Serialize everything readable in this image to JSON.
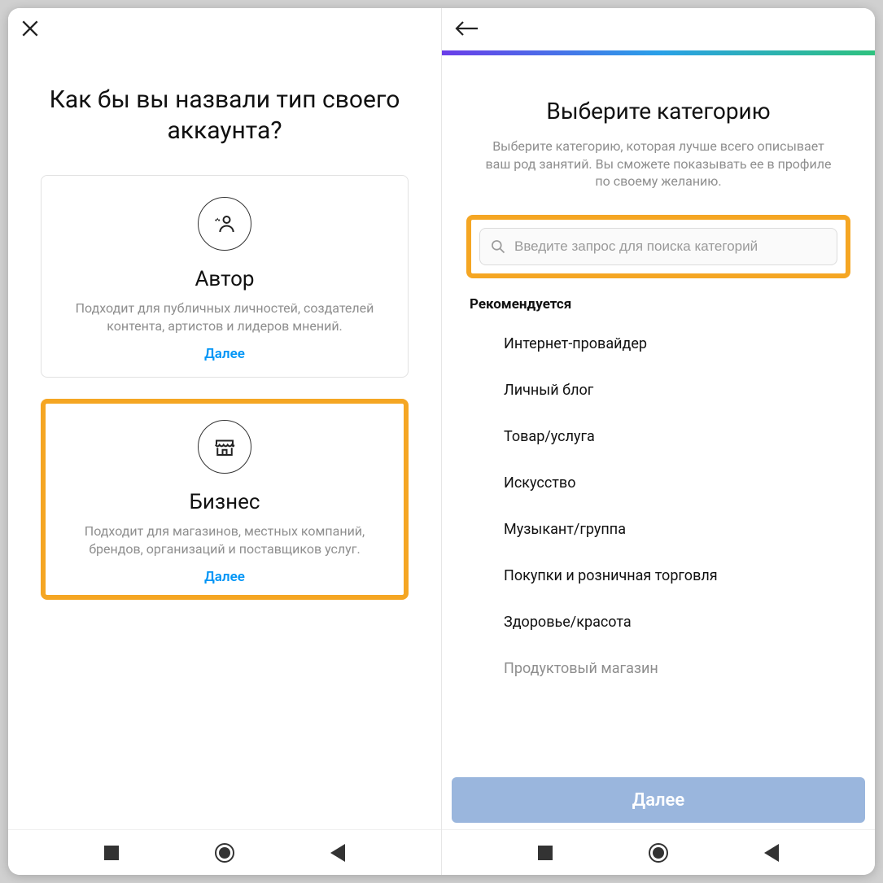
{
  "left": {
    "heading": "Как бы вы назвали тип своего аккаунта?",
    "cards": {
      "author": {
        "title": "Автор",
        "desc": "Подходит для публичных личностей, создателей контента, артистов и лидеров мнений.",
        "next": "Далее"
      },
      "business": {
        "title": "Бизнес",
        "desc": "Подходит для магазинов, местных компаний, брендов, организаций и поставщиков услуг.",
        "next": "Далее"
      }
    }
  },
  "right": {
    "heading": "Выберите категорию",
    "sub": "Выберите категорию, которая лучше всего описывает ваш род занятий. Вы сможете показывать ее в профиле по своему желанию.",
    "search_placeholder": "Введите запрос для поиска категорий",
    "recommended_label": "Рекомендуется",
    "categories": [
      "Интернет-провайдер",
      "Личный блог",
      "Товар/услуга",
      "Искусство",
      "Музыкант/группа",
      "Покупки и розничная торговля",
      "Здоровье/красота",
      "Продуктовый магазин"
    ],
    "next_button": "Далее"
  },
  "highlight_color": "#f5a623",
  "accent_color": "#0095f6"
}
